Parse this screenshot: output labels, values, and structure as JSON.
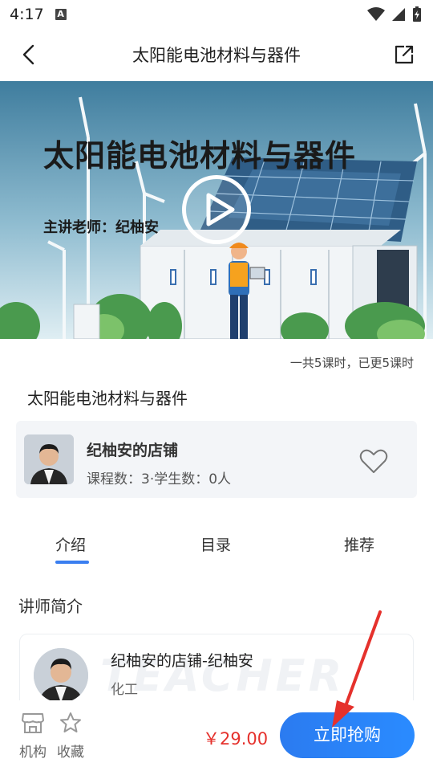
{
  "status_bar": {
    "time": "4:17",
    "badge": "A"
  },
  "nav": {
    "title": "太阳能电池材料与器件"
  },
  "hero": {
    "title": "太阳能电池材料与器件",
    "subtitle": "主讲老师：纪柚安"
  },
  "course": {
    "lesson_count": "一共5课时，已更5课时",
    "title": "太阳能电池材料与器件"
  },
  "shop": {
    "name": "纪柚安的店铺",
    "stats": "课程数：3·学生数：0人"
  },
  "tabs": [
    "介绍",
    "目录",
    "推荐"
  ],
  "section": {
    "title": "讲师简介"
  },
  "teacher": {
    "name": "纪柚安的店铺-纪柚安",
    "field": "化工",
    "watermark": "TEACHER"
  },
  "bottom": {
    "org_label": "机构",
    "fav_label": "收藏",
    "price": "￥29.00",
    "buy_label": "立即抢购"
  },
  "colors": {
    "accent": "#3a7ef0",
    "price": "#e5312c",
    "card_bg": "#f3f5f8"
  }
}
